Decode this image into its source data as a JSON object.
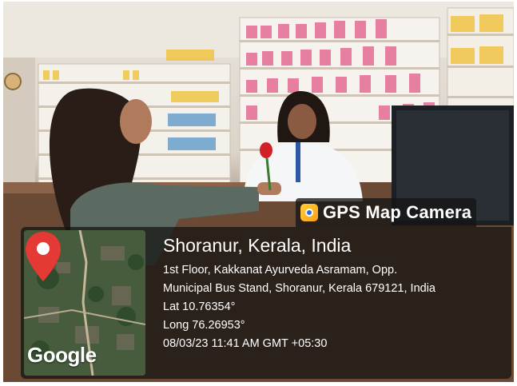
{
  "stamp": {
    "brand": "GPS Map Camera",
    "icon": "gps-map-camera-app-icon",
    "place_title": "Shoranur, Kerala, India",
    "address_line1": "1st Floor, Kakkanat Ayurveda Asramam, Opp.",
    "address_line2": "Municipal Bus Stand, Shoranur, Kerala 679121, India",
    "latitude": "Lat 10.76354°",
    "longitude": "Long 76.26953°",
    "datetime": "08/03/23 11:41 AM GMT +05:30",
    "map_logo": "Google",
    "pin_color": "#e53935"
  }
}
